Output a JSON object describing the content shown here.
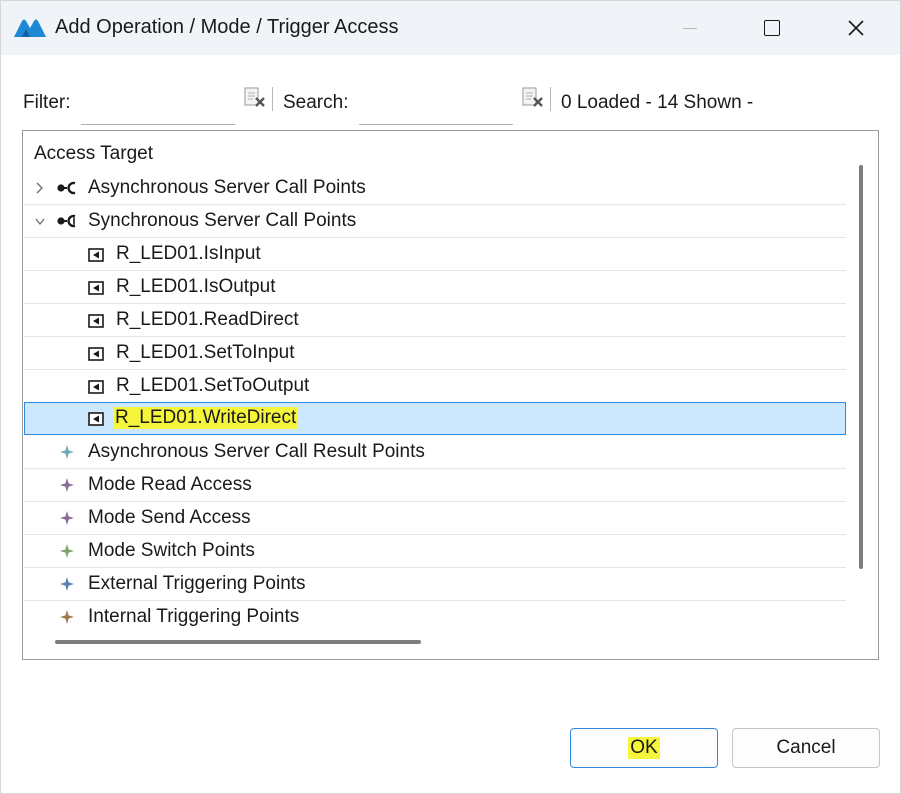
{
  "window": {
    "title": "Add Operation / Mode / Trigger Access",
    "minimize_icon": "minimize-icon",
    "maximize_icon": "maximize-icon",
    "close_icon": "close-icon"
  },
  "toolbar": {
    "filter_label": "Filter:",
    "filter_value": "",
    "search_label": "Search:",
    "search_value": "",
    "status": "0 Loaded - 14 Shown -"
  },
  "tree": {
    "header": "Access Target",
    "rows": [
      {
        "label": "Asynchronous Server Call Points",
        "icon": "async-call-point-icon",
        "expander": "collapsed"
      },
      {
        "label": "Synchronous Server Call Points",
        "icon": "sync-call-point-icon",
        "expander": "expanded"
      },
      {
        "label": "R_LED01.IsInput",
        "icon": "port-left-icon"
      },
      {
        "label": "R_LED01.IsOutput",
        "icon": "port-left-icon"
      },
      {
        "label": "R_LED01.ReadDirect",
        "icon": "port-left-icon"
      },
      {
        "label": "R_LED01.SetToInput",
        "icon": "port-left-icon"
      },
      {
        "label": "R_LED01.SetToOutput",
        "icon": "port-left-icon"
      },
      {
        "label": "R_LED01.WriteDirect",
        "icon": "port-left-icon",
        "selected": true,
        "highlighted": true
      },
      {
        "label": "Asynchronous Server Call Result Points",
        "icon": "star-icon",
        "color": "#6ea8b5"
      },
      {
        "label": "Mode Read Access",
        "icon": "star-icon",
        "color": "#8a6a96"
      },
      {
        "label": "Mode Send Access",
        "icon": "star-icon",
        "color": "#8a6a96"
      },
      {
        "label": "Mode Switch Points",
        "icon": "star-icon",
        "color": "#7fa26a"
      },
      {
        "label": "External Triggering Points",
        "icon": "star-icon",
        "color": "#5b7fb5"
      },
      {
        "label": "Internal Triggering Points",
        "icon": "star-icon",
        "color": "#a0784c"
      }
    ]
  },
  "buttons": {
    "ok": "OK",
    "cancel": "Cancel"
  },
  "colors": {
    "selection_bg": "#cce8ff",
    "selection_border": "#2a8be0",
    "highlight": "#f5f53c",
    "titlebar_bg": "#f0f4f9"
  }
}
